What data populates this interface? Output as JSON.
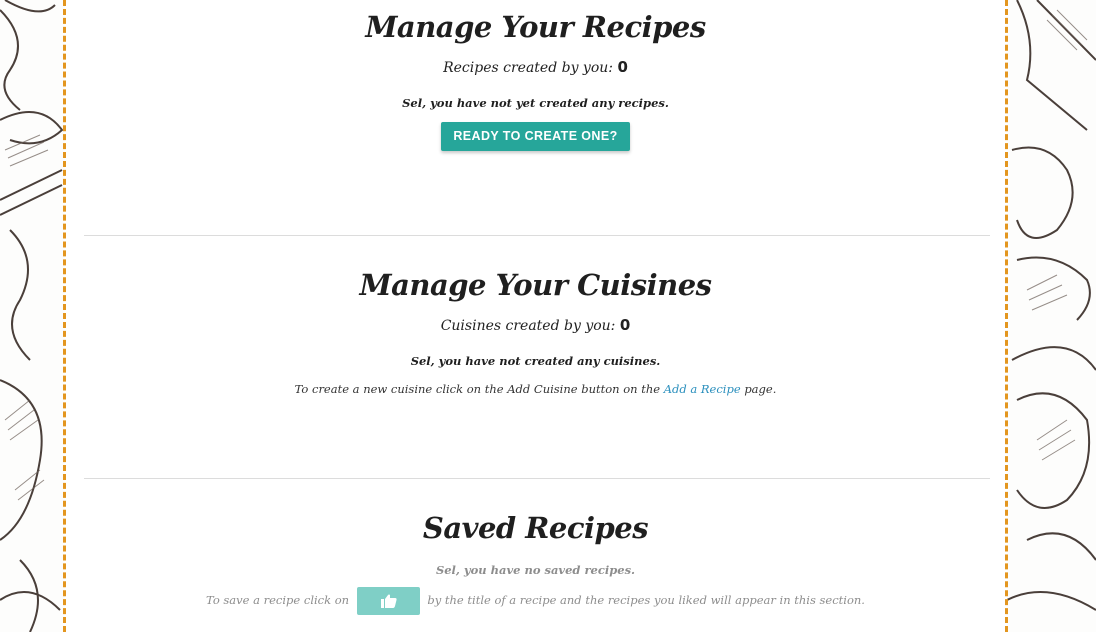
{
  "recipes": {
    "heading": "Manage Your Recipes",
    "count_label": "Recipes created by you:",
    "count": "0",
    "empty_note": "Sel, you have not yet created any recipes.",
    "create_button": "READY TO CREATE ONE?"
  },
  "cuisines": {
    "heading": "Manage Your Cuisines",
    "count_label": "Cuisines created by you:",
    "count": "0",
    "empty_note": "Sel, you have not created any cuisines.",
    "help_prefix": "To create a new cuisine click on the Add Cuisine button on the",
    "help_link": "Add a Recipe",
    "help_suffix": "page."
  },
  "saved": {
    "heading": "Saved Recipes",
    "empty_note": "Sel, you have no saved recipes.",
    "help_prefix": "To save a recipe click on",
    "help_suffix": "by the title of a recipe and the recipes you liked will appear in this section.",
    "like_icon": "thumbs-up-icon"
  },
  "colors": {
    "accent": "#26a69a",
    "accent_light": "#7fcfc6",
    "border_dash": "#e3961f",
    "link": "#2a8fbd"
  }
}
